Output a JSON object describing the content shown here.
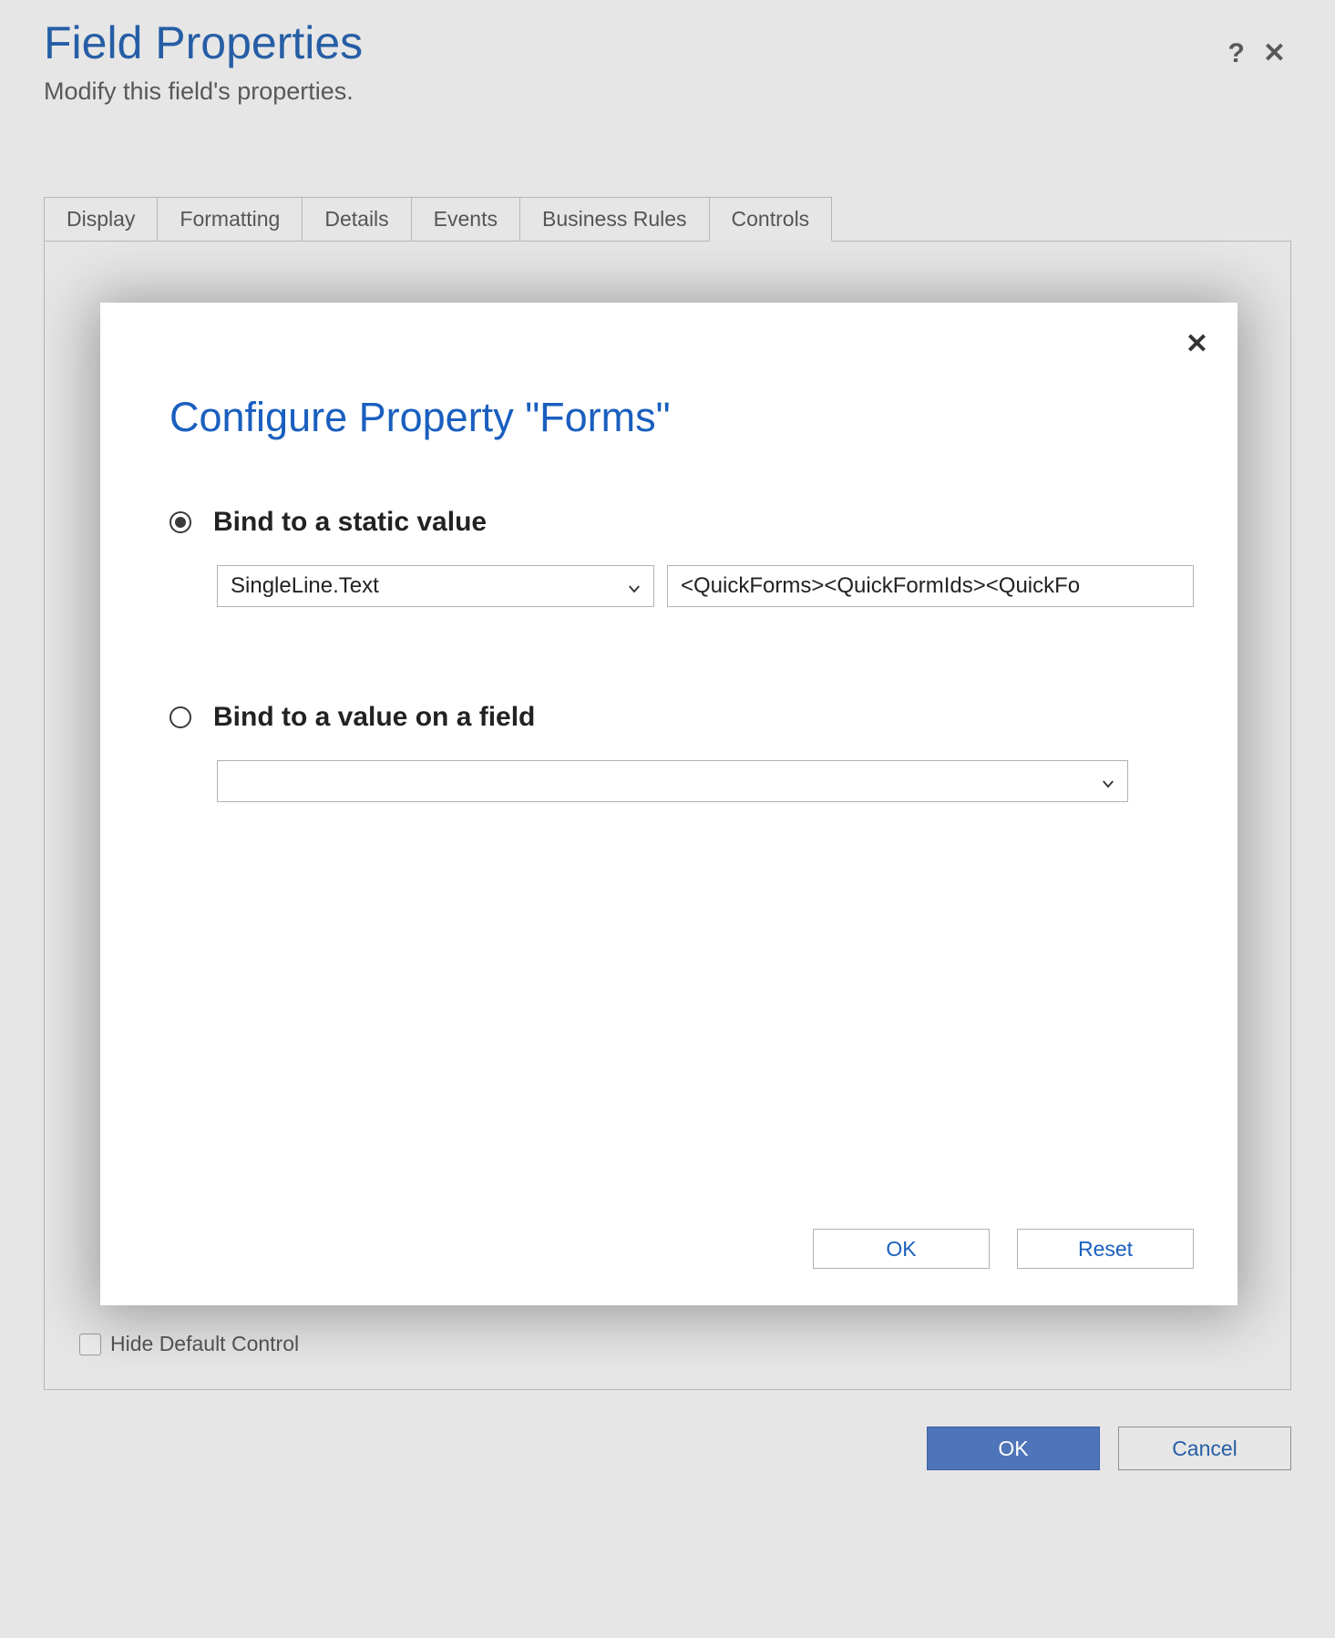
{
  "header": {
    "title": "Field Properties",
    "subtitle": "Modify this field's properties."
  },
  "tabs": {
    "items": [
      "Display",
      "Formatting",
      "Details",
      "Events",
      "Business Rules",
      "Controls"
    ],
    "active_index": 5
  },
  "content": {
    "hide_default_label": "Hide Default Control"
  },
  "footer": {
    "ok_label": "OK",
    "cancel_label": "Cancel"
  },
  "modal": {
    "title": "Configure Property \"Forms\"",
    "option1": {
      "label": "Bind to a static value",
      "type_select": "SingleLine.Text",
      "value": "<QuickForms><QuickFormIds><QuickFo"
    },
    "option2": {
      "label": "Bind to a value on a field",
      "field_select": ""
    },
    "ok_label": "OK",
    "reset_label": "Reset"
  }
}
